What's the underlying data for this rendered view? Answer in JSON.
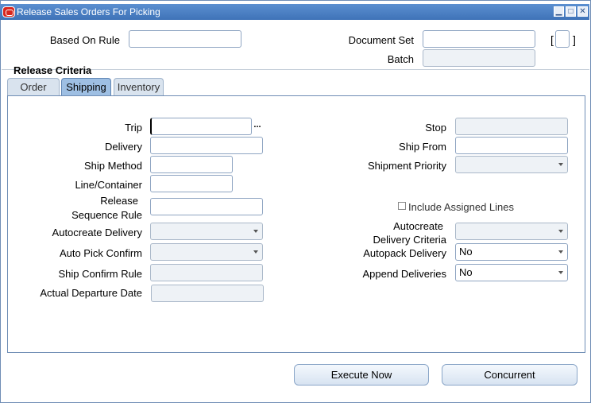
{
  "window": {
    "title": "Release Sales Orders For Picking",
    "controls": [
      "minimize-icon",
      "maximize-icon",
      "close-icon"
    ]
  },
  "header": {
    "based_on_rule_label": "Based On Rule",
    "based_on_rule_value": "",
    "document_set_label": "Document Set",
    "document_set_value": "",
    "batch_label": "Batch",
    "batch_value": "",
    "bracket_open": "[",
    "bracket_close": "]"
  },
  "section": {
    "title": "Release Criteria"
  },
  "tabs": [
    {
      "label": "Order",
      "active": false
    },
    {
      "label": "Shipping",
      "active": true
    },
    {
      "label": "Inventory",
      "active": false
    }
  ],
  "shipping": {
    "trip_label": "Trip",
    "trip_value": "",
    "trip_lov": "...",
    "delivery_label": "Delivery",
    "delivery_value": "",
    "ship_method_label": "Ship Method",
    "ship_method_value": "",
    "line_container_label": "Line/Container",
    "line_container_value": "",
    "release_sequence_rule_label_1": "Release",
    "release_sequence_rule_label_2": "Sequence Rule",
    "release_sequence_rule_value": "",
    "autocreate_delivery_label": "Autocreate Delivery",
    "autocreate_delivery_value": "",
    "auto_pick_confirm_label": "Auto Pick Confirm",
    "auto_pick_confirm_value": "",
    "ship_confirm_rule_label": "Ship Confirm Rule",
    "ship_confirm_rule_value": "",
    "actual_departure_date_label": "Actual Departure Date",
    "actual_departure_date_value": "",
    "stop_label": "Stop",
    "stop_value": "",
    "ship_from_label": "Ship From",
    "ship_from_value": "",
    "shipment_priority_label": "Shipment Priority",
    "shipment_priority_value": "",
    "include_assigned_lines_label": "Include Assigned Lines",
    "include_assigned_lines_checked": false,
    "autocreate_delivery_criteria_label_1": "Autocreate",
    "autocreate_delivery_criteria_label_2": "Delivery Criteria",
    "autocreate_delivery_criteria_value": "",
    "autopack_delivery_label": "Autopack Delivery",
    "autopack_delivery_value": "No",
    "append_deliveries_label": "Append Deliveries",
    "append_deliveries_value": "No"
  },
  "buttons": {
    "execute_now": "Execute Now",
    "concurrent": "Concurrent"
  }
}
